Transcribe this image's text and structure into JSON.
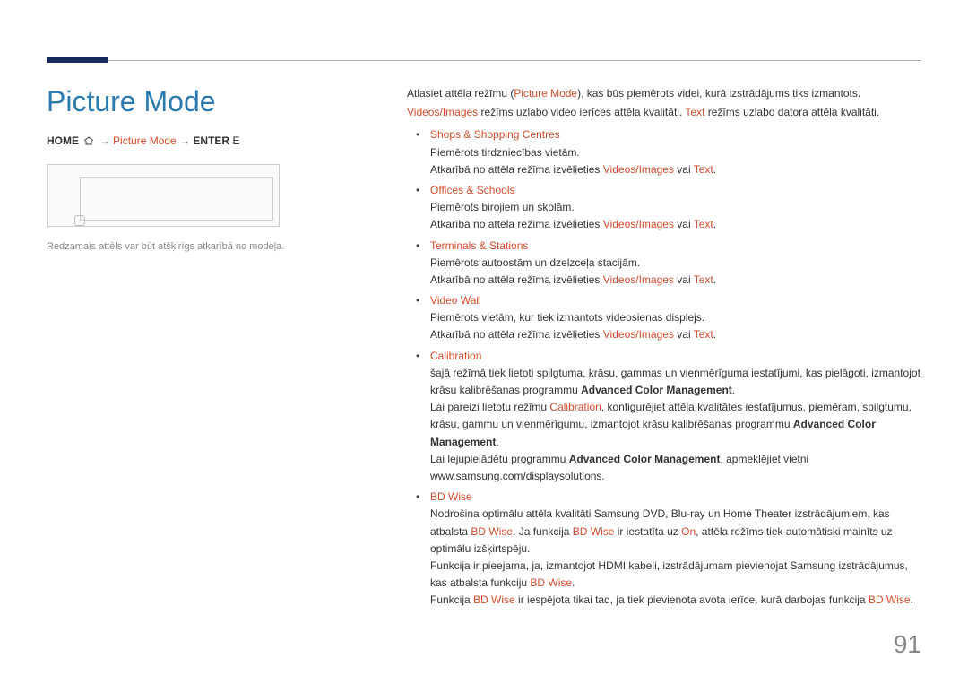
{
  "title": "Picture Mode",
  "path": {
    "p1": "HOME",
    "arrow1": "→",
    "p2": "Picture Mode",
    "arrow2": "→",
    "p3": "ENTER",
    "p4": "E"
  },
  "caption": "Redzamais attēls var būt atšķirīgs atkarībā no modeļa.",
  "intro": {
    "l1a": "Atlasiet attēla režīmu (",
    "l1b": "Picture Mode",
    "l1c": "), kas būs piemērots videi, kurā izstrādājums tiks izmantots.",
    "l2a": "Videos/Images",
    "l2b": " režīms uzlabo video ierīces attēla kvalitāti. ",
    "l2c": "Text",
    "l2d": " režīms uzlabo datora attēla kvalitāti."
  },
  "items": {
    "shops": {
      "title": "Shops & Shopping Centres",
      "desc1": "Piemērots tirdzniecības vietām.",
      "desc2a": "Atkarībā no attēla režīma izvēlieties ",
      "desc2b": "Videos/Images",
      "desc2c": " vai ",
      "desc2d": "Text",
      "desc2e": "."
    },
    "offices": {
      "title": "Offices & Schools",
      "desc1": "Piemērots birojiem un skolām.",
      "desc2a": "Atkarībā no attēla režīma izvēlieties ",
      "desc2b": "Videos/Images",
      "desc2c": " vai ",
      "desc2d": "Text",
      "desc2e": "."
    },
    "terminals": {
      "title": "Terminals & Stations",
      "desc1": "Piemērots autoostām un dzelzceļa stacijām.",
      "desc2a": "Atkarībā no attēla režīma izvēlieties ",
      "desc2b": "Videos/Images",
      "desc2c": " vai ",
      "desc2d": "Text",
      "desc2e": "."
    },
    "videowall": {
      "title": "Video Wall",
      "desc1": "Piemērots vietām, kur tiek izmantots videosienas displejs.",
      "desc2a": "Atkarībā no attēla režīma izvēlieties ",
      "desc2b": "Videos/Images",
      "desc2c": " vai ",
      "desc2d": "Text",
      "desc2e": "."
    },
    "calibration": {
      "title": "Calibration",
      "desc1a": "šajā režīmā tiek lietoti spilgtuma, krāsu, gammas un vienmērīguma iestatījumi, kas pielāgoti, izmantojot krāsu kalibrēšanas programmu ",
      "desc1b": "Advanced Color Management",
      "desc1c": ".",
      "sub1a": "Lai pareizi lietotu režīmu ",
      "sub1b": "Calibration",
      "sub1c": ", konfigurējiet attēla kvalitātes iestatījumus, piemēram, spilgtumu, krāsu, gammu un vienmērīgumu, izmantojot krāsu kalibrēšanas programmu ",
      "sub1d": "Advanced Color Management",
      "sub1e": ".",
      "sub2a": "Lai lejupielādētu programmu ",
      "sub2b": "Advanced Color Management",
      "sub2c": ", apmeklējiet vietni www.samsung.com/displaysolutions."
    },
    "bdwise": {
      "title": "BD Wise",
      "desc1a": "Nodrošina optimālu attēla kvalitāti Samsung DVD, Blu-ray un Home Theater izstrādājumiem, kas atbalsta ",
      "desc1b": "BD Wise",
      "desc1c": ". Ja funkcija ",
      "desc1d": "BD Wise",
      "desc1e": " ir iestatīta uz ",
      "desc1f": "On",
      "desc1g": ", attēla režīms tiek automātiski mainīts uz optimālu izšķirtspēju.",
      "sub1a": "Funkcija ir pieejama, ja, izmantojot HDMI kabeli, izstrādājumam pievienojat Samsung izstrādājumus, kas atbalsta funkciju ",
      "sub1b": "BD Wise",
      "sub1c": ".",
      "sub2a": "Funkcija ",
      "sub2b": "BD Wise",
      "sub2c": " ir iespējota tikai tad, ja tiek pievienota avota ierīce, kurā darbojas funkcija ",
      "sub2d": "BD Wise",
      "sub2e": "."
    }
  },
  "pageNumber": "91"
}
